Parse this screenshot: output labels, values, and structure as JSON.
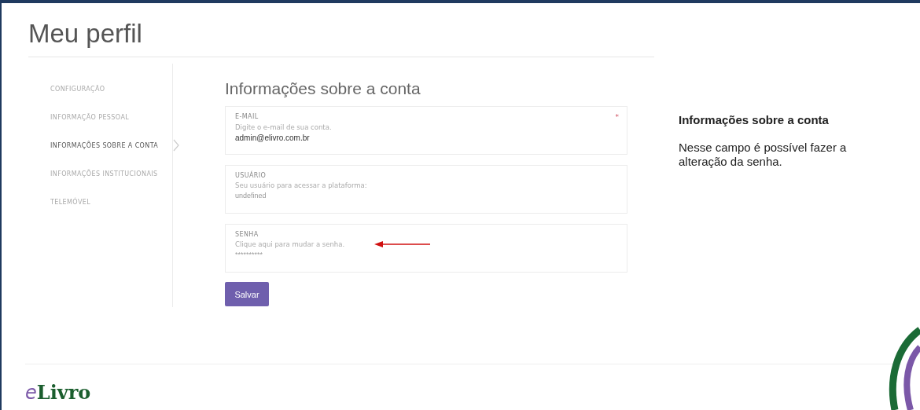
{
  "page_title": "Meu perfil",
  "nav": [
    {
      "label": "CONFIGURAÇÃO",
      "selected": false
    },
    {
      "label": "INFORMAÇÃO PESSOAL",
      "selected": false
    },
    {
      "label": "INFORMAÇÕES SOBRE A CONTA",
      "selected": true
    },
    {
      "label": "INFORMAÇÕES INSTITUCIONAIS",
      "selected": false
    },
    {
      "label": "TELEMÓVEL",
      "selected": false
    }
  ],
  "section_title": "Informações sobre a conta",
  "fields": [
    {
      "label": "E-MAIL",
      "hint": "Digite o e-mail de sua conta.",
      "value": "admin@elivro.com.br",
      "required_mark": "*"
    },
    {
      "label": "USUÁRIO",
      "hint": "Seu usuário para acessar a plataforma:",
      "placeholder": "undefined"
    },
    {
      "label": "SENHA",
      "hint": "Clique aqui para mudar a senha.",
      "placeholder": "**********",
      "pointed": true
    }
  ],
  "save_button": "Salvar",
  "note": {
    "title": "Informações sobre a conta",
    "text": "Nesse campo é possível fazer a alteração da senha."
  },
  "logo": {
    "mark": "e",
    "text": "Livro"
  }
}
